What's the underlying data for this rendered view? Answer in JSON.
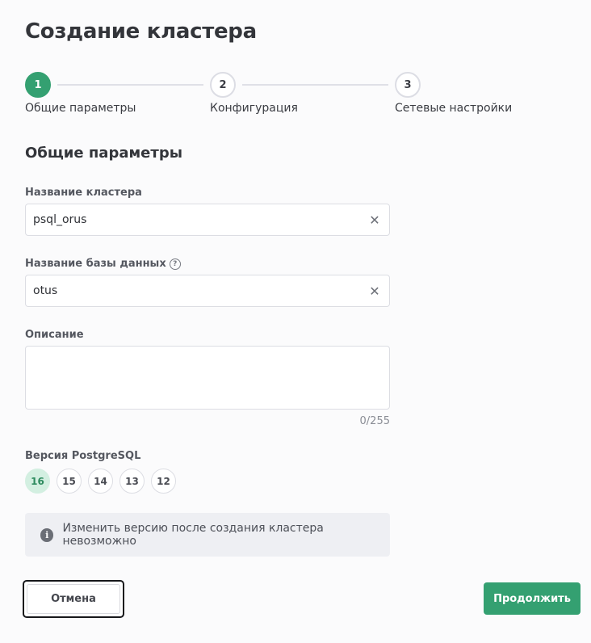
{
  "page_title": "Создание кластера",
  "stepper": {
    "steps": [
      {
        "number": "1",
        "label": "Общие параметры"
      },
      {
        "number": "2",
        "label": "Конфигурация"
      },
      {
        "number": "3",
        "label": "Сетевые настройки"
      }
    ],
    "active_step": 1
  },
  "section_title": "Общие параметры",
  "fields": {
    "cluster_name": {
      "label": "Название кластера",
      "value": "psql_orus"
    },
    "database_name": {
      "label": "Название базы данных",
      "value": "otus",
      "help_icon": "question-circle-icon"
    },
    "description": {
      "label": "Описание",
      "value": "",
      "counter": "0/255"
    }
  },
  "postgres_version": {
    "label": "Версия PostgreSQL",
    "options": [
      "16",
      "15",
      "14",
      "13",
      "12"
    ],
    "selected": "16"
  },
  "info": {
    "icon": "info-icon",
    "text": "Изменить версию после создания кластера невозможно"
  },
  "buttons": {
    "cancel": "Отмена",
    "continue": "Продолжить"
  },
  "colors": {
    "accent": "#34a071",
    "accent_light": "#d3efe1"
  }
}
